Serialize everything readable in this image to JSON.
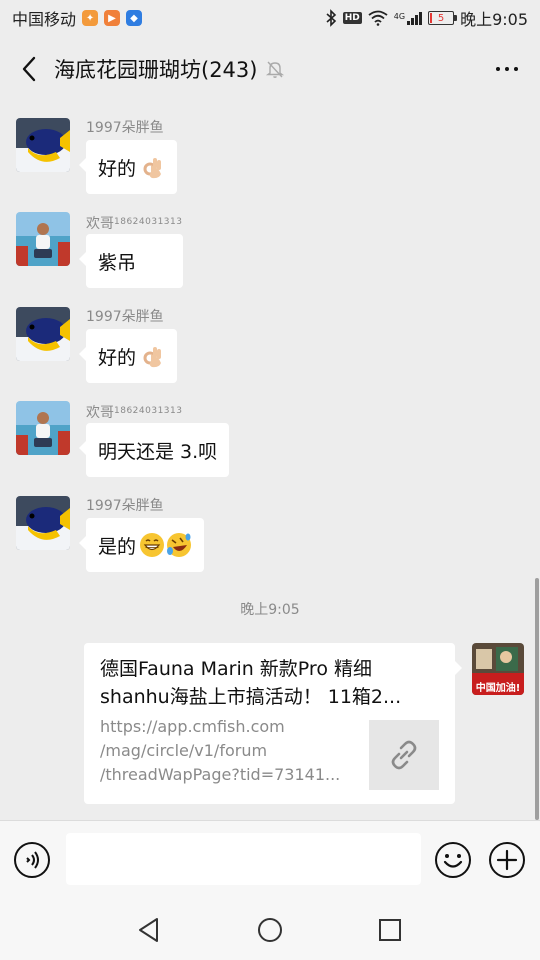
{
  "status_bar": {
    "carrier": "中国移动",
    "network": "4G",
    "hd_label": "HD",
    "battery": "5",
    "battery_level": 0.05,
    "time": "晚上9:05"
  },
  "header": {
    "title": "海底花园珊瑚坊(243)"
  },
  "messages": [
    {
      "sender": "1997朵胖鱼",
      "sender_suffix": "",
      "text": "好的",
      "emoji": [
        "ok-hand-emoji"
      ]
    },
    {
      "sender": "欢哥",
      "sender_suffix": "18624031313",
      "text": "紫吊",
      "emoji": []
    },
    {
      "sender": "1997朵胖鱼",
      "sender_suffix": "",
      "text": "好的",
      "emoji": [
        "ok-hand-emoji"
      ]
    },
    {
      "sender": "欢哥",
      "sender_suffix": "18624031313",
      "text": "明天还是 3.呗",
      "emoji": []
    },
    {
      "sender": "1997朵胖鱼",
      "sender_suffix": "",
      "text": "是的",
      "emoji": [
        "grinning-emoji",
        "rolling-laughing-emoji"
      ]
    }
  ],
  "timestamp": "晚上9:05",
  "link_card": {
    "title_line1": "德国Fauna Marin 新款Pro 精细",
    "title_line2": "shanhu海盐上市搞活动！ 11箱2...",
    "url_line1": "https://app.cmfish.com",
    "url_line2": "/mag/circle/v1/forum",
    "url_line3": "/threadWapPage?tid=73141..."
  },
  "self_avatar_caption": "中国加油!",
  "input": {
    "placeholder": "",
    "value": ""
  },
  "colors": {
    "background": "#ededed",
    "bubble": "#ffffff",
    "meta_text": "#8a8a8a",
    "battery_low": "#e53935"
  }
}
